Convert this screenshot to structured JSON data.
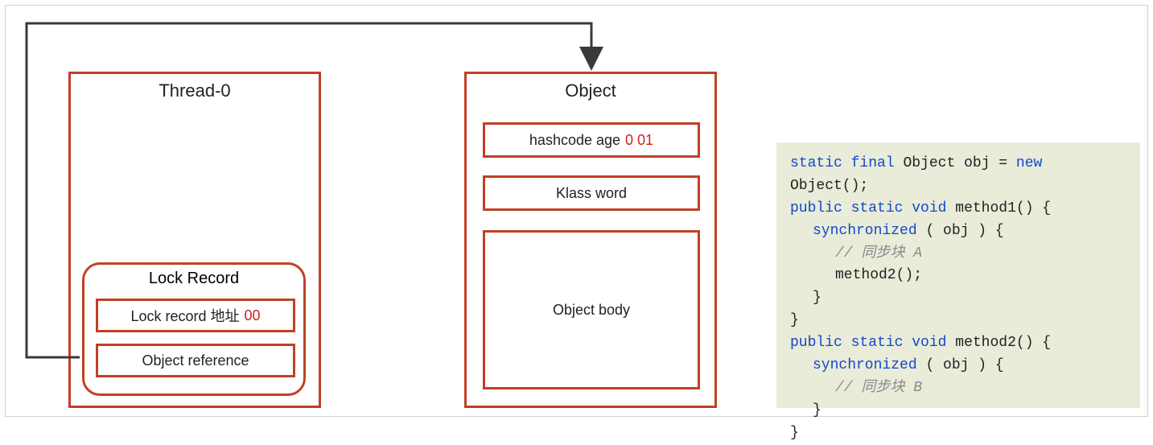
{
  "thread": {
    "title": "Thread-0",
    "lock_record": {
      "title": "Lock Record",
      "lock_record_addr_label": "Lock record 地址",
      "lock_record_addr_bits": "00",
      "object_reference_label": "Object reference"
    }
  },
  "object": {
    "title": "Object",
    "markword": {
      "label": "hashcode age",
      "bits": "0 01"
    },
    "klass_word": "Klass word",
    "body": "Object body"
  },
  "code": {
    "line1_static": "static",
    "line1_final": "final",
    "line1_objdecl": " Object obj = ",
    "line1_new": "new",
    "line1_objtail": " Object();",
    "line2_public": "public",
    "line2_static": "static",
    "line2_void": "void",
    "line2_method1": " method1() {",
    "line3_sync": "synchronized",
    "line3_obj": "( obj ) {",
    "line4_comment": "// 同步块 A",
    "line5_method2_call": "method2();",
    "line6_close": "}",
    "line7_close": "}",
    "line8_public": "public",
    "line8_static": "static",
    "line8_void": "void",
    "line8_method2": " method2() {",
    "line9_sync": "synchronized",
    "line9_obj": "( obj ) {",
    "line10_comment": "// 同步块 B",
    "line11_close": "}",
    "line12_close": "}"
  }
}
